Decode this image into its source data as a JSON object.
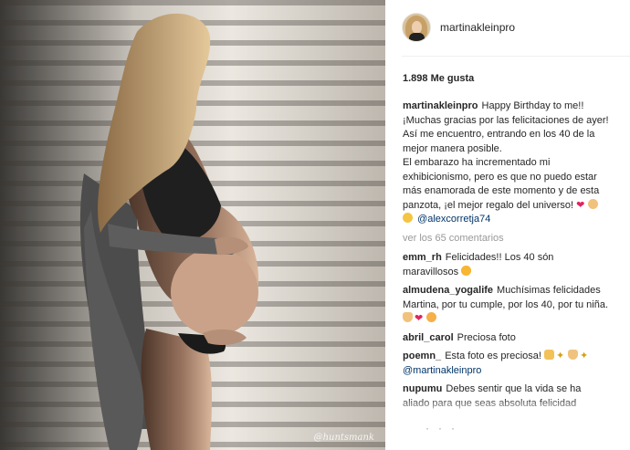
{
  "photo": {
    "watermark": "@huntsmank"
  },
  "post": {
    "author": "martinakleinpro",
    "likes": "1.898 Me gusta",
    "caption": {
      "user": "martinakleinpro",
      "lines": [
        "Happy Birthday to me!!",
        "¡Muchas gracias por las felicitaciones de ayer! Así me encuentro, entrando en los 40 de la mejor manera posible.",
        "El embarazo ha incrementado mi exhibicionismo, pero es que no puedo estar más enamorada de este momento y de esta panzota, ¡el mejor regalo del universo!"
      ],
      "emoji": [
        "heart",
        "baby",
        "angel"
      ],
      "mention": "@alexcorretja74"
    },
    "view_all": "ver los 65 comentarios",
    "comments": [
      {
        "user": "emm_rh",
        "text": "Felicidades!! Los 40 són maravillosos",
        "emoji": [
          "hearteyes"
        ]
      },
      {
        "user": "almudena_yogalife",
        "text": "Muchísimas felicidades Martina, por tu cumple, por los 40, por tu niña.",
        "emoji": [
          "bow",
          "heart",
          "blush"
        ]
      },
      {
        "user": "abril_carol",
        "text": "Preciosa foto",
        "emoji": []
      },
      {
        "user": "poemn_",
        "text": "Esta foto es preciosa!",
        "emoji": [
          "clap",
          "sparkle",
          "bow",
          "sparkle"
        ],
        "mention": "@martinakleinpro"
      },
      {
        "user": "nupumu",
        "text": "Debes sentir que la vida se ha aliado para que seas absoluta felicidad",
        "emoji": []
      }
    ]
  },
  "colors": {
    "link": "#003569",
    "muted": "#999999",
    "text": "#262626"
  }
}
